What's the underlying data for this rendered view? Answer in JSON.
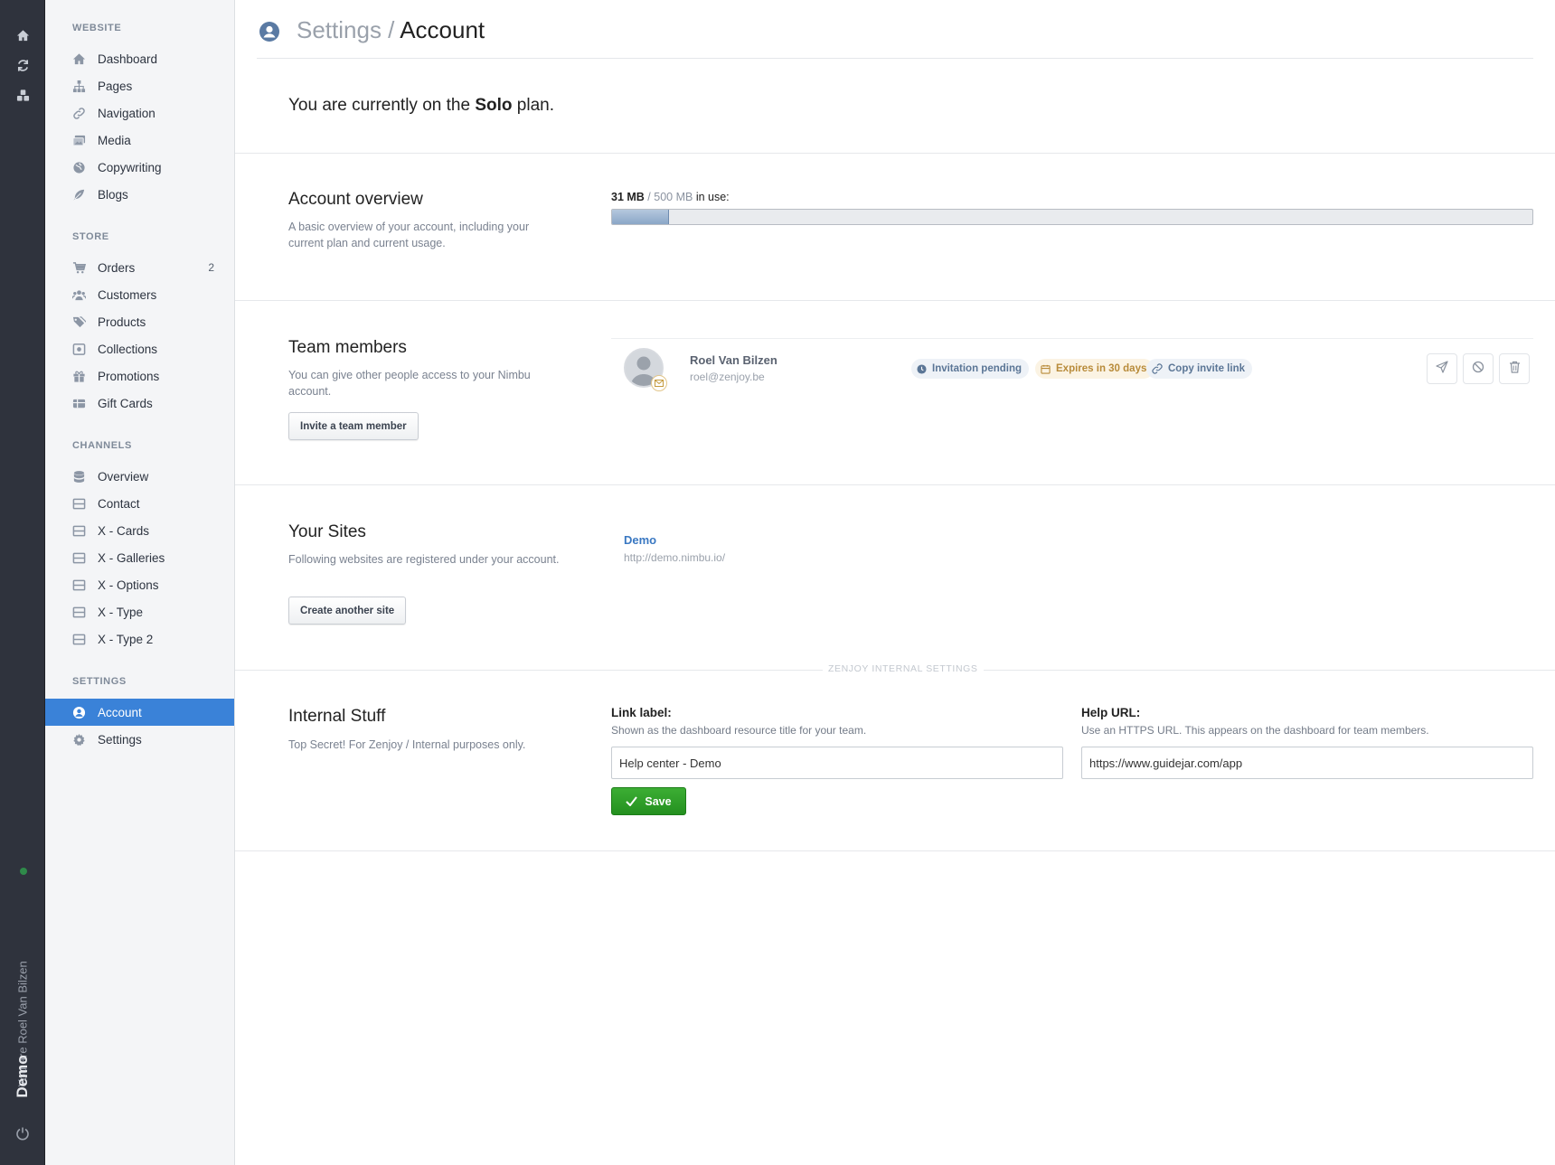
{
  "rail": {
    "user_label": "You are Roel Van Bilzen",
    "site_label": "Demo"
  },
  "sidebar": {
    "sections": [
      {
        "heading": "WEBSITE",
        "items": [
          {
            "label": "Dashboard",
            "icon": "home-icon"
          },
          {
            "label": "Pages",
            "icon": "sitemap-icon"
          },
          {
            "label": "Navigation",
            "icon": "link-icon"
          },
          {
            "label": "Media",
            "icon": "images-icon"
          },
          {
            "label": "Copywriting",
            "icon": "globe-icon"
          },
          {
            "label": "Blogs",
            "icon": "feather-icon"
          }
        ]
      },
      {
        "heading": "STORE",
        "items": [
          {
            "label": "Orders",
            "icon": "cart-icon",
            "badge": "2"
          },
          {
            "label": "Customers",
            "icon": "users-icon"
          },
          {
            "label": "Products",
            "icon": "tags-icon"
          },
          {
            "label": "Collections",
            "icon": "collection-icon"
          },
          {
            "label": "Promotions",
            "icon": "gift-icon"
          },
          {
            "label": "Gift Cards",
            "icon": "giftcard-icon"
          }
        ]
      },
      {
        "heading": "CHANNELS",
        "items": [
          {
            "label": "Overview",
            "icon": "database-icon"
          },
          {
            "label": "Contact",
            "icon": "channel-icon"
          },
          {
            "label": "X - Cards",
            "icon": "channel-icon"
          },
          {
            "label": "X - Galleries",
            "icon": "channel-icon"
          },
          {
            "label": "X - Options",
            "icon": "channel-icon"
          },
          {
            "label": "X - Type",
            "icon": "channel-icon"
          },
          {
            "label": "X - Type 2",
            "icon": "channel-icon"
          }
        ]
      },
      {
        "heading": "SETTINGS",
        "items": [
          {
            "label": "Account",
            "icon": "user-circle-icon",
            "active": true
          },
          {
            "label": "Settings",
            "icon": "gear-icon"
          }
        ]
      }
    ]
  },
  "header": {
    "crumb_parent": "Settings",
    "crumb_sep": " / ",
    "crumb_current": "Account"
  },
  "plan": {
    "prefix": "You are currently on the ",
    "name": "Solo",
    "suffix": " plan."
  },
  "overview": {
    "title": "Account overview",
    "description": "A basic overview of your account, including your current plan and current usage.",
    "used": "31 MB",
    "separator": " / ",
    "total": "500 MB",
    "suffix": " in use:",
    "usage_fraction": 0.062
  },
  "team": {
    "title": "Team members",
    "description": "You can give other people access to your Nimbu account.",
    "invite_button": "Invite a team member",
    "members": [
      {
        "name": "Roel Van Bilzen",
        "email": "roel@zenjoy.be",
        "status": "Invitation pending",
        "expires": "Expires in 30 days",
        "copy_link": "Copy invite link"
      }
    ]
  },
  "sites": {
    "title": "Your Sites",
    "description": "Following websites are registered under your account.",
    "create_button": "Create another site",
    "list": [
      {
        "name": "Demo",
        "url": "http://demo.nimbu.io/"
      }
    ]
  },
  "internal": {
    "section_label": "ZENJOY INTERNAL SETTINGS",
    "title": "Internal Stuff",
    "description": "Top Secret! For Zenjoy / Internal purposes only.",
    "link_label": {
      "label": "Link label:",
      "help": "Shown as the dashboard resource title for your team.",
      "value": "Help center - Demo"
    },
    "help_url": {
      "label": "Help URL:",
      "help": "Use an HTTPS URL. This appears on the dashboard for team members.",
      "value": "https://www.guidejar.com/app"
    },
    "save_button": "Save"
  },
  "colors": {
    "rail_bg": "#2f333d",
    "sidebar_bg": "#f4f5f7",
    "accent": "#3a82d8",
    "link": "#3a78c2",
    "save_green": "#2ea02a"
  }
}
